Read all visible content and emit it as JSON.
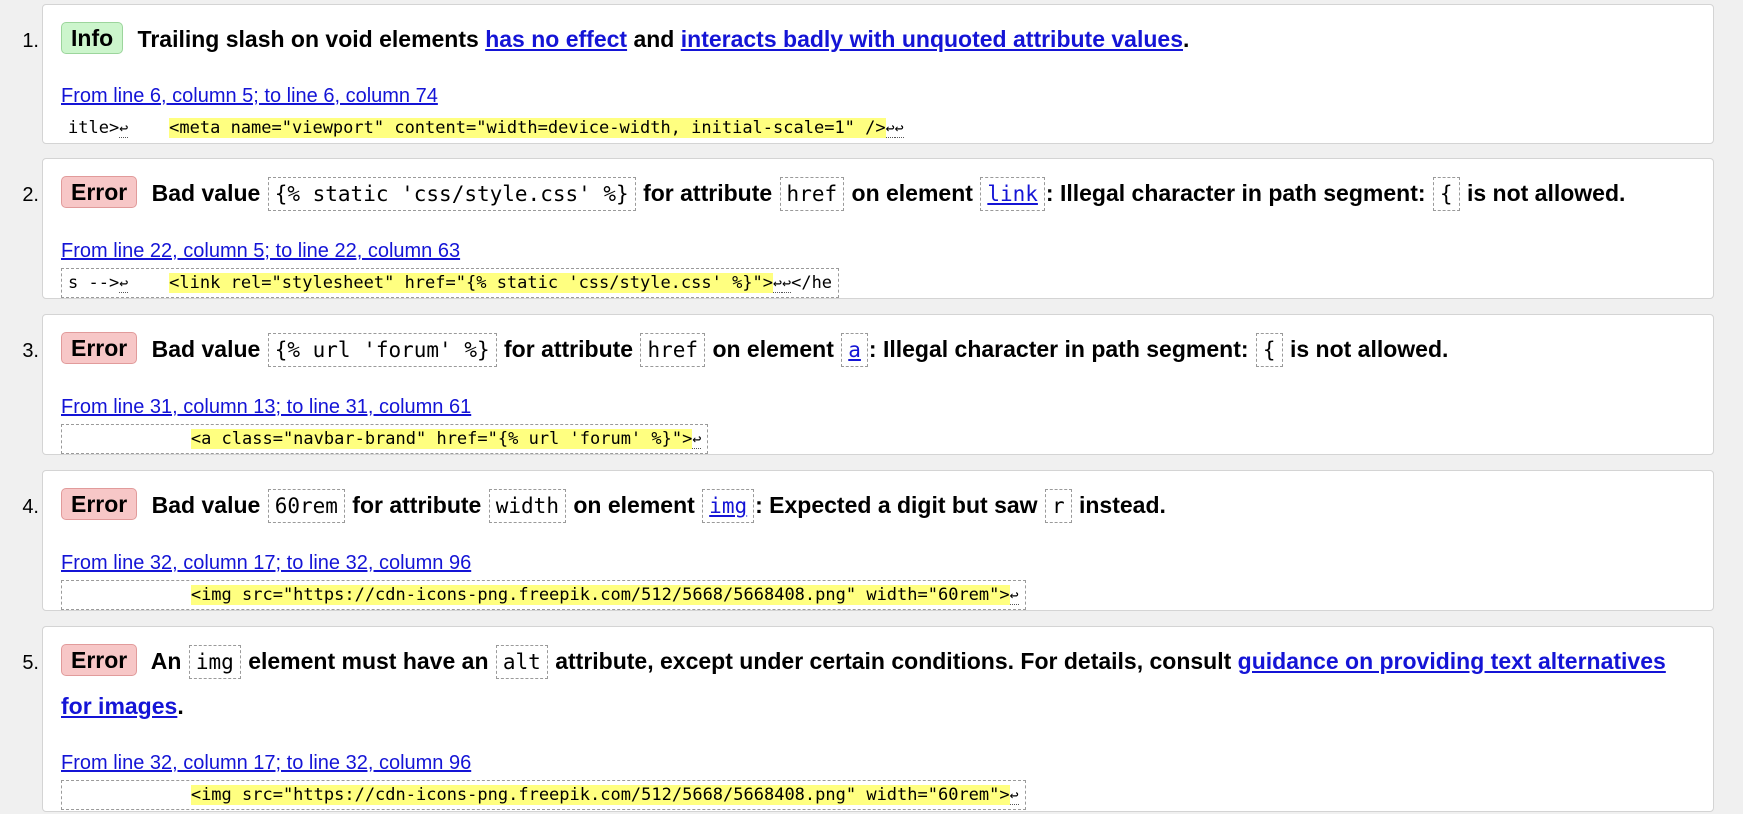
{
  "messages": [
    {
      "number": "1.",
      "type_label": "Info",
      "text_a": "Trailing slash on void elements",
      "link1": "has no effect",
      "text_b": "and",
      "link2": "interacts badly with unquoted attribute values",
      "text_c": ".",
      "location": "From line 6, column 5; to line 6, column 74",
      "extract_pre": "itle>",
      "extract_mid": "    ",
      "extract_hl": "<meta name=\"viewport\" content=\"width=device-width, initial-scale=1\" />",
      "extract_post": ""
    },
    {
      "number": "2.",
      "type_label": "Error",
      "bad_value_label": "Bad value",
      "value": "{% static 'css/style.css' %}",
      "for_attr_label": "for attribute",
      "attribute": "href",
      "on_element_label": "on element",
      "element": "link",
      "reason": ": Illegal character in path segment:",
      "char": "{",
      "tail": "is not allowed.",
      "location": "From line 22, column 5; to line 22, column 63",
      "extract_pre": "s -->",
      "extract_mid": "    ",
      "extract_hl": "<link rel=\"stylesheet\" href=\"{% static 'css/style.css' %}\">",
      "extract_post": "</he"
    },
    {
      "number": "3.",
      "type_label": "Error",
      "bad_value_label": "Bad value",
      "value": "{% url 'forum' %}",
      "for_attr_label": "for attribute",
      "attribute": "href",
      "on_element_label": "on element",
      "element": "a",
      "reason": ": Illegal character in path segment:",
      "char": "{",
      "tail": "is not allowed.",
      "location": "From line 31, column 13; to line 31, column 61",
      "extract_pre": "",
      "extract_mid": "            ",
      "extract_hl": "<a class=\"navbar-brand\" href=\"{% url 'forum' %}\">",
      "extract_post": ""
    },
    {
      "number": "4.",
      "type_label": "Error",
      "bad_value_label": "Bad value",
      "value": "60rem",
      "for_attr_label": "for attribute",
      "attribute": "width",
      "on_element_label": "on element",
      "element": "img",
      "reason": ": Expected a digit but saw",
      "char": "r",
      "tail": "instead.",
      "location": "From line 32, column 17; to line 32, column 96",
      "extract_pre": "",
      "extract_mid": "            ",
      "extract_hl": "<img src=\"https://cdn-icons-png.freepik.com/512/5668/5668408.png\" width=\"60rem\">",
      "extract_post": ""
    },
    {
      "number": "5.",
      "type_label": "Error",
      "text_a": "An",
      "code1": "img",
      "text_b": "element must have an",
      "code2": "alt",
      "text_c": "attribute, except under certain conditions. For details, consult",
      "link": "guidance on providing text alternatives for images",
      "text_d": ".",
      "location": "From line 32, column 17; to line 32, column 96",
      "extract_pre": "",
      "extract_mid": "            ",
      "extract_hl": "<img src=\"https://cdn-icons-png.freepik.com/512/5668/5668408.png\" width=\"60rem\">",
      "extract_post": ""
    }
  ],
  "glyphs": {
    "line_feed": "↩"
  },
  "colors": {
    "info_badge": "#ccf5cc",
    "error_badge": "#f7c7c7",
    "highlight": "#ffff80",
    "link": "#1414d6"
  }
}
